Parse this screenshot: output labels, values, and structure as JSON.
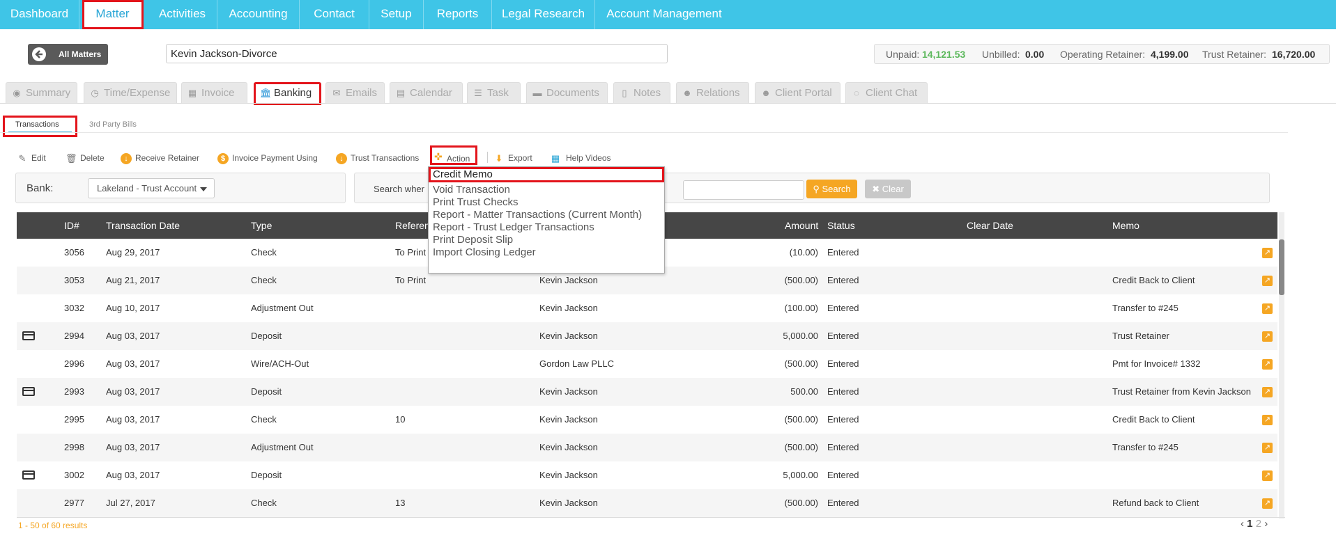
{
  "topnav": {
    "items": [
      "Dashboard",
      "Matter",
      "Activities",
      "Accounting",
      "Contact",
      "Setup",
      "Reports",
      "Legal Research",
      "Account Management"
    ],
    "active": "Matter"
  },
  "header": {
    "all_matters_label": "All Matters",
    "matter_name": "Kevin Jackson-Divorce",
    "unpaid_label": "Unpaid:",
    "unpaid_value": "14,121.53",
    "unbilled_label": "Unbilled:",
    "unbilled_value": "0.00",
    "operating_label": "Operating Retainer:",
    "operating_value": "4,199.00",
    "trust_label": "Trust Retainer:",
    "trust_value": "16,720.00"
  },
  "tabs": [
    {
      "label": "Summary",
      "icon": "dashboard-icon"
    },
    {
      "label": "Time/Expense",
      "icon": "clock-icon"
    },
    {
      "label": "Invoice",
      "icon": "calculator-icon"
    },
    {
      "label": "Banking",
      "icon": "bank-icon"
    },
    {
      "label": "Emails",
      "icon": "envelope-icon"
    },
    {
      "label": "Calendar",
      "icon": "calendar-icon"
    },
    {
      "label": "Task",
      "icon": "tasks-icon"
    },
    {
      "label": "Documents",
      "icon": "folder-icon"
    },
    {
      "label": "Notes",
      "icon": "file-icon"
    },
    {
      "label": "Relations",
      "icon": "users-icon"
    },
    {
      "label": "Client Portal",
      "icon": "user-group-icon"
    },
    {
      "label": "Client Chat",
      "icon": "chat-icon"
    }
  ],
  "subtabs": [
    "Transactions",
    "3rd Party Bills"
  ],
  "toolbar": {
    "edit": "Edit",
    "delete": "Delete",
    "receive_retainer": "Receive Retainer",
    "invoice_payment": "Invoice Payment Using",
    "trust_transactions": "Trust Transactions",
    "action": "Action",
    "export": "Export",
    "help_videos": "Help Videos"
  },
  "filter": {
    "bank_label": "Bank:",
    "bank_value": "Lakeland - Trust Account",
    "search_label": "Search wher",
    "search_button": "Search",
    "clear_button": "Clear"
  },
  "table": {
    "headers": [
      "ID#",
      "Transaction Date",
      "Type",
      "Referen",
      "Amount",
      "Status",
      "Clear Date",
      "Memo"
    ],
    "rows": [
      {
        "card": false,
        "id": "3056",
        "date": "Aug 29, 2017",
        "type": "Check",
        "ref": "To Print",
        "payee": "",
        "amount": "(10.00)",
        "status": "Entered",
        "memo": ""
      },
      {
        "card": false,
        "id": "3053",
        "date": "Aug 21, 2017",
        "type": "Check",
        "ref": "To Print",
        "payee": "Kevin Jackson",
        "amount": "(500.00)",
        "status": "Entered",
        "memo": "Credit Back to Client"
      },
      {
        "card": false,
        "id": "3032",
        "date": "Aug 10, 2017",
        "type": "Adjustment Out",
        "ref": "",
        "payee": "Kevin Jackson",
        "amount": "(100.00)",
        "status": "Entered",
        "memo": "Transfer to #245"
      },
      {
        "card": true,
        "id": "2994",
        "date": "Aug 03, 2017",
        "type": "Deposit",
        "ref": "",
        "payee": "Kevin Jackson",
        "amount": "5,000.00",
        "status": "Entered",
        "memo": "Trust Retainer"
      },
      {
        "card": false,
        "id": "2996",
        "date": "Aug 03, 2017",
        "type": "Wire/ACH-Out",
        "ref": "",
        "payee": "Gordon Law PLLC",
        "amount": "(500.00)",
        "status": "Entered",
        "memo": "Pmt for Invoice# 1332"
      },
      {
        "card": true,
        "id": "2993",
        "date": "Aug 03, 2017",
        "type": "Deposit",
        "ref": "",
        "payee": "Kevin Jackson",
        "amount": "500.00",
        "status": "Entered",
        "memo": "Trust Retainer from Kevin Jackson"
      },
      {
        "card": false,
        "id": "2995",
        "date": "Aug 03, 2017",
        "type": "Check",
        "ref": "10",
        "payee": "Kevin Jackson",
        "amount": "(500.00)",
        "status": "Entered",
        "memo": "Credit Back to Client"
      },
      {
        "card": false,
        "id": "2998",
        "date": "Aug 03, 2017",
        "type": "Adjustment Out",
        "ref": "",
        "payee": "Kevin Jackson",
        "amount": "(500.00)",
        "status": "Entered",
        "memo": "Transfer to #245"
      },
      {
        "card": true,
        "id": "3002",
        "date": "Aug 03, 2017",
        "type": "Deposit",
        "ref": "",
        "payee": "Kevin Jackson",
        "amount": "5,000.00",
        "status": "Entered",
        "memo": ""
      },
      {
        "card": false,
        "id": "2977",
        "date": "Jul 27, 2017",
        "type": "Check",
        "ref": "13",
        "payee": "Kevin Jackson",
        "amount": "(500.00)",
        "status": "Entered",
        "memo": "Refund back to Client"
      }
    ]
  },
  "footer": {
    "results": "1 - 50 of 60 results",
    "page_current": "1",
    "page_next": "2"
  },
  "action_menu": {
    "items": [
      "Credit Memo",
      "Void Transaction",
      "Print Trust Checks",
      "Report - Matter Transactions (Current Month)",
      "Report - Trust Ledger Transactions",
      "Print Deposit Slip",
      "Import Closing Ledger"
    ]
  },
  "colors": {
    "nav_bg": "#3fc5e7",
    "highlight": "#e3141b",
    "accent_orange": "#f5a623",
    "unpaid_green": "#5cb85c",
    "table_header": "#464646"
  }
}
